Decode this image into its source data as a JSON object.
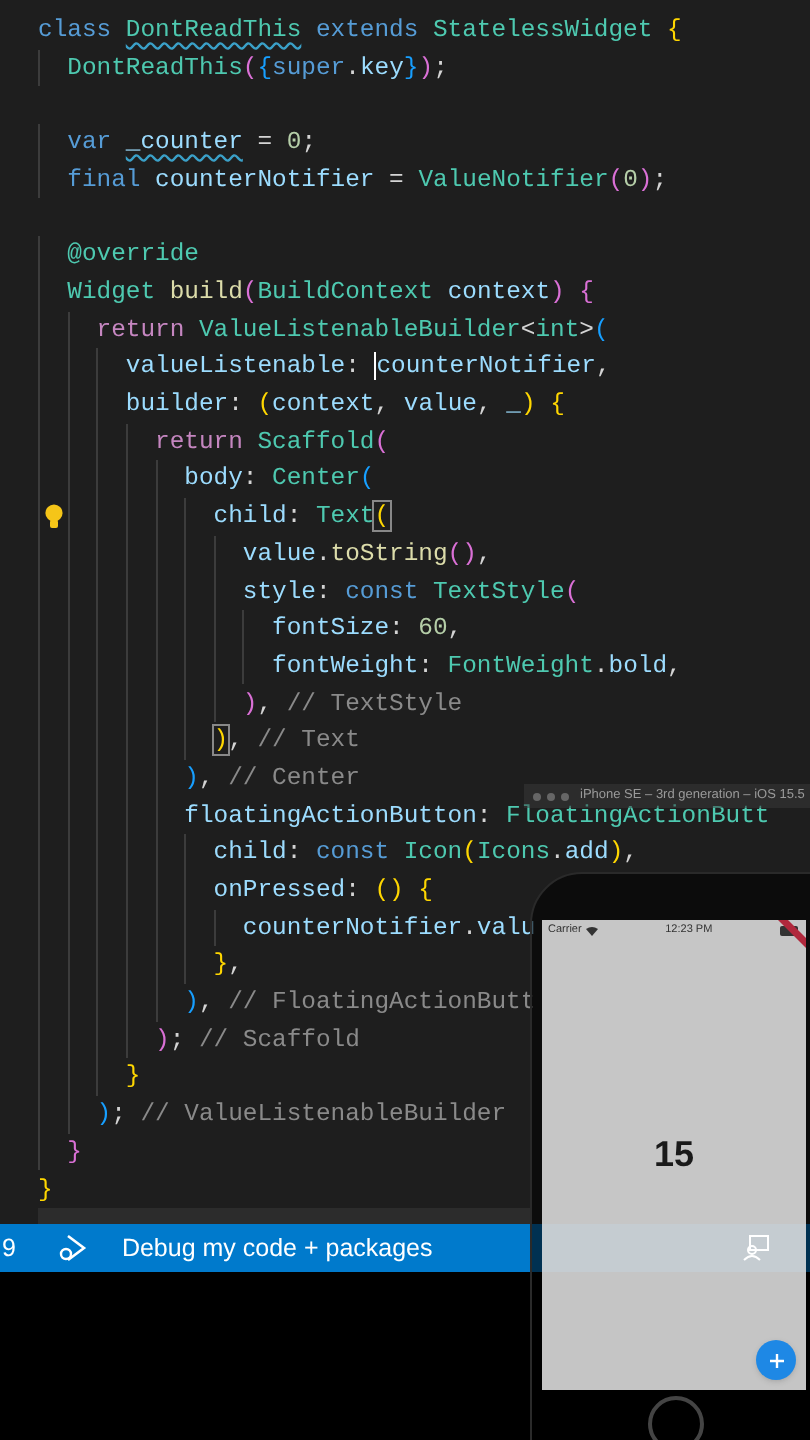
{
  "editor": {
    "lines": [
      {
        "tokens": [
          {
            "kind": "keyword",
            "text": "class "
          },
          {
            "kind": "type",
            "text": "DontReadThis",
            "squiggle": true
          },
          {
            "kind": "keyword",
            "text": " extends "
          },
          {
            "kind": "type",
            "text": "StatelessWidget "
          },
          {
            "kind": "bracket1",
            "text": "{"
          }
        ]
      },
      {
        "tokens": [
          {
            "kind": "type",
            "text": "  DontReadThis"
          },
          {
            "kind": "bracket2",
            "text": "("
          },
          {
            "kind": "bracket3",
            "text": "{"
          },
          {
            "kind": "keyword",
            "text": "super"
          },
          {
            "kind": "punct",
            "text": "."
          },
          {
            "kind": "variable",
            "text": "key"
          },
          {
            "kind": "bracket3",
            "text": "}"
          },
          {
            "kind": "bracket2",
            "text": ")"
          },
          {
            "kind": "punct",
            "text": ";"
          }
        ]
      },
      {
        "gap_before": true,
        "tokens": [
          {
            "kind": "keyword",
            "text": "  var "
          },
          {
            "kind": "variable",
            "text": "_counter",
            "squiggle": true
          },
          {
            "kind": "punct",
            "text": " = "
          },
          {
            "kind": "number",
            "text": "0"
          },
          {
            "kind": "punct",
            "text": ";"
          }
        ]
      },
      {
        "tokens": [
          {
            "kind": "keyword",
            "text": "  final "
          },
          {
            "kind": "variable",
            "text": "counterNotifier"
          },
          {
            "kind": "punct",
            "text": " = "
          },
          {
            "kind": "type",
            "text": "ValueNotifier"
          },
          {
            "kind": "bracket2",
            "text": "("
          },
          {
            "kind": "number",
            "text": "0"
          },
          {
            "kind": "bracket2",
            "text": ")"
          },
          {
            "kind": "punct",
            "text": ";"
          }
        ]
      },
      {
        "gap_before": true,
        "tokens": [
          {
            "kind": "type",
            "text": "  @override"
          }
        ]
      },
      {
        "tokens": [
          {
            "kind": "type",
            "text": "  Widget "
          },
          {
            "kind": "function",
            "text": "build"
          },
          {
            "kind": "bracket2",
            "text": "("
          },
          {
            "kind": "type",
            "text": "BuildContext "
          },
          {
            "kind": "variable",
            "text": "context"
          },
          {
            "kind": "bracket2",
            "text": ") {"
          }
        ]
      },
      {
        "tokens": [
          {
            "kind": "control",
            "text": "    return "
          },
          {
            "kind": "type",
            "text": "ValueListenableBuilder"
          },
          {
            "kind": "punct",
            "text": "<"
          },
          {
            "kind": "type",
            "text": "int"
          },
          {
            "kind": "punct",
            "text": ">"
          },
          {
            "kind": "bracket3",
            "text": "("
          }
        ]
      },
      {
        "tokens": [
          {
            "kind": "variable",
            "text": "      valueListenable"
          },
          {
            "kind": "punct",
            "text": ": "
          },
          {
            "kind": "variable",
            "text": "counterNotifier",
            "cursor": true
          },
          {
            "kind": "punct",
            "text": ","
          }
        ]
      },
      {
        "tokens": [
          {
            "kind": "variable",
            "text": "      builder"
          },
          {
            "kind": "punct",
            "text": ": "
          },
          {
            "kind": "bracket1",
            "text": "("
          },
          {
            "kind": "variable",
            "text": "context"
          },
          {
            "kind": "punct",
            "text": ", "
          },
          {
            "kind": "variable",
            "text": "value"
          },
          {
            "kind": "punct",
            "text": ", "
          },
          {
            "kind": "variable",
            "text": "_"
          },
          {
            "kind": "bracket1",
            "text": ") {"
          }
        ]
      },
      {
        "tokens": [
          {
            "kind": "control",
            "text": "        return "
          },
          {
            "kind": "type",
            "text": "Scaffold"
          },
          {
            "kind": "bracket2",
            "text": "("
          }
        ]
      },
      {
        "tokens": [
          {
            "kind": "variable",
            "text": "          body"
          },
          {
            "kind": "punct",
            "text": ": "
          },
          {
            "kind": "type",
            "text": "Center"
          },
          {
            "kind": "bracket3",
            "text": "("
          }
        ]
      },
      {
        "lightbulb": true,
        "tokens": [
          {
            "kind": "variable",
            "text": "            child"
          },
          {
            "kind": "punct",
            "text": ": "
          },
          {
            "kind": "type",
            "text": "Text"
          },
          {
            "kind": "bracket1",
            "text": "(",
            "matched": true
          }
        ]
      },
      {
        "tokens": [
          {
            "kind": "variable",
            "text": "              value"
          },
          {
            "kind": "punct",
            "text": "."
          },
          {
            "kind": "function",
            "text": "toString"
          },
          {
            "kind": "bracket2",
            "text": "()"
          },
          {
            "kind": "punct",
            "text": ","
          }
        ]
      },
      {
        "tokens": [
          {
            "kind": "variable",
            "text": "              style"
          },
          {
            "kind": "punct",
            "text": ": "
          },
          {
            "kind": "keyword",
            "text": "const "
          },
          {
            "kind": "type",
            "text": "TextStyle"
          },
          {
            "kind": "bracket2",
            "text": "("
          }
        ]
      },
      {
        "tokens": [
          {
            "kind": "variable",
            "text": "                fontSize"
          },
          {
            "kind": "punct",
            "text": ": "
          },
          {
            "kind": "number",
            "text": "60"
          },
          {
            "kind": "punct",
            "text": ","
          }
        ]
      },
      {
        "tokens": [
          {
            "kind": "variable",
            "text": "                fontWeight"
          },
          {
            "kind": "punct",
            "text": ": "
          },
          {
            "kind": "type",
            "text": "FontWeight"
          },
          {
            "kind": "punct",
            "text": "."
          },
          {
            "kind": "variable",
            "text": "bold"
          },
          {
            "kind": "punct",
            "text": ","
          }
        ]
      },
      {
        "tokens": [
          {
            "kind": "bracket2",
            "text": "              )"
          },
          {
            "kind": "punct",
            "text": ", "
          },
          {
            "kind": "comment",
            "text": "// TextStyle"
          }
        ]
      },
      {
        "tokens": [
          {
            "kind": "bracket1",
            "text": "            )",
            "matched": true
          },
          {
            "kind": "punct",
            "text": ", "
          },
          {
            "kind": "comment",
            "text": "// Text"
          }
        ]
      },
      {
        "tokens": [
          {
            "kind": "bracket3",
            "text": "          )"
          },
          {
            "kind": "punct",
            "text": ", "
          },
          {
            "kind": "comment",
            "text": "// Center"
          }
        ]
      },
      {
        "tokens": [
          {
            "kind": "variable",
            "text": "          floatingActionButton"
          },
          {
            "kind": "punct",
            "text": ": "
          },
          {
            "kind": "type",
            "text": "FloatingActionButt"
          }
        ]
      },
      {
        "tokens": [
          {
            "kind": "variable",
            "text": "            child"
          },
          {
            "kind": "punct",
            "text": ": "
          },
          {
            "kind": "keyword",
            "text": "const "
          },
          {
            "kind": "type",
            "text": "Icon"
          },
          {
            "kind": "bracket1",
            "text": "("
          },
          {
            "kind": "type",
            "text": "Icons"
          },
          {
            "kind": "punct",
            "text": "."
          },
          {
            "kind": "variable",
            "text": "add"
          },
          {
            "kind": "bracket1",
            "text": ")"
          },
          {
            "kind": "punct",
            "text": ","
          }
        ]
      },
      {
        "tokens": [
          {
            "kind": "variable",
            "text": "            onPressed"
          },
          {
            "kind": "punct",
            "text": ": "
          },
          {
            "kind": "bracket1",
            "text": "() {"
          }
        ]
      },
      {
        "tokens": [
          {
            "kind": "variable",
            "text": "              counterNotifier"
          },
          {
            "kind": "punct",
            "text": "."
          },
          {
            "kind": "variable",
            "text": "valu"
          }
        ]
      },
      {
        "tokens": [
          {
            "kind": "bracket1",
            "text": "            }"
          },
          {
            "kind": "punct",
            "text": ","
          }
        ]
      },
      {
        "tokens": [
          {
            "kind": "bracket3",
            "text": "          )"
          },
          {
            "kind": "punct",
            "text": ", "
          },
          {
            "kind": "comment",
            "text": "// FloatingActionButt"
          }
        ]
      },
      {
        "tokens": [
          {
            "kind": "bracket2",
            "text": "        )"
          },
          {
            "kind": "punct",
            "text": "; "
          },
          {
            "kind": "comment",
            "text": "// Scaffold"
          }
        ]
      },
      {
        "tokens": [
          {
            "kind": "bracket1",
            "text": "      }"
          }
        ]
      },
      {
        "tokens": [
          {
            "kind": "bracket3",
            "text": "    )"
          },
          {
            "kind": "punct",
            "text": "; "
          },
          {
            "kind": "comment",
            "text": "// ValueListenableBuilder"
          }
        ]
      },
      {
        "tokens": [
          {
            "kind": "bracket2",
            "text": "  }"
          }
        ]
      },
      {
        "tokens": [
          {
            "kind": "bracket1",
            "text": "}"
          }
        ]
      }
    ]
  },
  "status_bar": {
    "line_fragment": "9",
    "label": "Debug my code + packages"
  },
  "simulator": {
    "title": "iPhone SE – 3rd generation – iOS 15.5",
    "carrier": "Carrier",
    "time": "12:23 PM",
    "counter": "15",
    "debug_banner": true
  }
}
